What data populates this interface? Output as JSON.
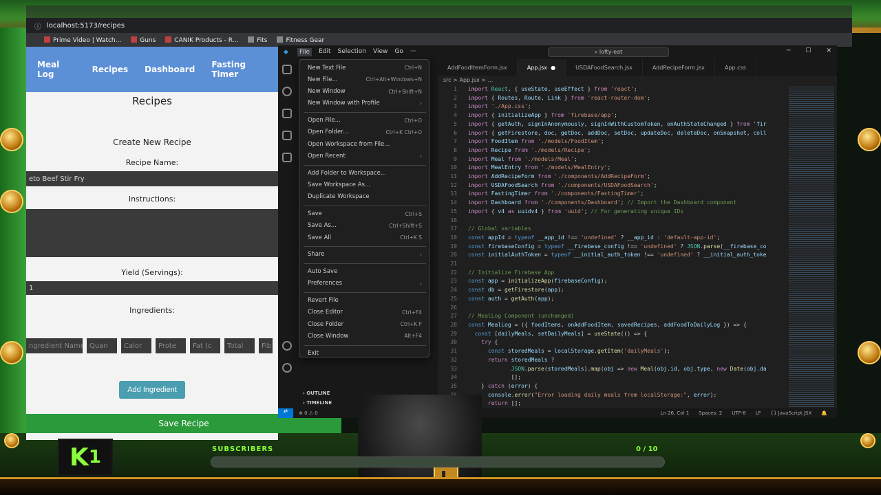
{
  "browser": {
    "url": "localhost:5173/recipes",
    "bookmarks": [
      "Prime Video | Watch...",
      "Guns",
      "CANIK Products - R...",
      "Fits",
      "Fitness Gear"
    ]
  },
  "app": {
    "nav": [
      "Meal Log",
      "Recipes",
      "Dashboard",
      "Fasting Timer"
    ],
    "page_title": "Recipes",
    "form_title": "Create New Recipe",
    "recipe_name_label": "Recipe Name:",
    "recipe_name_value": "eto Beef Stir Fry",
    "instructions_label": "Instructions:",
    "yield_label": "Yield (Servings):",
    "yield_value": "1",
    "ingredients_label": "Ingredients:",
    "ingredient_placeholders": [
      "ngredient Name",
      "Quan",
      "Calor",
      "Prote",
      "Fat (c",
      "Total",
      "Fib"
    ],
    "add_ingredient": "Add Ingredient",
    "save_recipe": "Save Recipe"
  },
  "vscode": {
    "menu": [
      "File",
      "Edit",
      "Selection",
      "View",
      "Go",
      "···"
    ],
    "search": "lofty-eat",
    "tabs": [
      "AddFoodItemForm.jsx",
      "App.jsx",
      "USDAFoodSearch.jsx",
      "AddRecipeForm.jsx",
      "App.css"
    ],
    "breadcrumb": "src > App.jsx > ...",
    "side_sections": [
      "OUTLINE",
      "TIMELINE"
    ],
    "status_left": "⊗ 0 ⚠ 0",
    "status_right": [
      "Ln 26, Col 1",
      "Spaces: 2",
      "UTF-8",
      "LF",
      "{} JavaScript JSX"
    ],
    "code": [
      "import React, { useState, useEffect } from 'react';",
      "import { Routes, Route, Link } from 'react-router-dom';",
      "import './App.css';",
      "import { initializeApp } from 'firebase/app';",
      "import { getAuth, signInAnonymously, signInWithCustomToken, onAuthStateChanged } from 'fir",
      "import { getFirestore, doc, getDoc, addDoc, setDoc, updateDoc, deleteDoc, onSnapshot, coll",
      "import FoodItem from './models/FoodItem';",
      "import Recipe from './models/Recipe';",
      "import Meal from './models/Meal';",
      "import MealEntry from './models/MealEntry';",
      "import AddRecipeForm from './components/AddRecipeForm';",
      "import USDAFoodSearch from './components/USDAFoodSearch';",
      "import FastingTimer from './components/FastingTimer';",
      "import Dashboard from './components/Dashboard'; // Import the Dashboard component",
      "import { v4 as uuidv4 } from 'uuid'; // For generating unique IDs",
      "",
      "// Global variables",
      "const appId = typeof __app_id !== 'undefined' ? __app_id : 'default-app-id';",
      "const firebaseConfig = typeof __firebase_config !== 'undefined' ? JSON.parse(__firebase_co",
      "const initialAuthToken = typeof __initial_auth_token !== 'undefined' ? __initial_auth_toke",
      "",
      "// Initialize Firebase App",
      "const app = initializeApp(firebaseConfig);",
      "const db = getFirestore(app);",
      "const auth = getAuth(app);",
      "",
      "// MealLog Component (unchanged)",
      "const MealLog = ({ foodItems, onAddFoodItem, savedRecipes, addFoodToDailyLog }) => {",
      "  const [dailyMeals, setDailyMeals] = useState(() => {",
      "    try {",
      "      const storedMeals = localStorage.getItem('dailyMeals');",
      "      return storedMeals ?",
      "             JSON.parse(storedMeals).map(obj => new Meal(obj.id, obj.type, new Date(obj.da",
      "             [];",
      "    } catch (error) {",
      "      console.error(\"Error loading daily meals from localStorage:\", error);",
      "      return [];"
    ]
  },
  "file_menu": [
    {
      "label": "New Text File",
      "key": "Ctrl+N"
    },
    {
      "label": "New File...",
      "key": "Ctrl+Alt+Windows+N"
    },
    {
      "label": "New Window",
      "key": "Ctrl+Shift+N"
    },
    {
      "label": "New Window with Profile",
      "key": "›"
    },
    {
      "label": "Open File...",
      "key": "Ctrl+O"
    },
    {
      "label": "Open Folder...",
      "key": "Ctrl+K Ctrl+O"
    },
    {
      "label": "Open Workspace from File...",
      "key": ""
    },
    {
      "label": "Open Recent",
      "key": "›"
    },
    {
      "label": "Add Folder to Workspace...",
      "key": ""
    },
    {
      "label": "Save Workspace As...",
      "key": ""
    },
    {
      "label": "Duplicate Workspace",
      "key": ""
    },
    {
      "label": "Save",
      "key": "Ctrl+S"
    },
    {
      "label": "Save As...",
      "key": "Ctrl+Shift+S"
    },
    {
      "label": "Save All",
      "key": "Ctrl+K S"
    },
    {
      "label": "Share",
      "key": "›"
    },
    {
      "label": "Auto Save",
      "key": ""
    },
    {
      "label": "Preferences",
      "key": "›"
    },
    {
      "label": "Revert File",
      "key": ""
    },
    {
      "label": "Close Editor",
      "key": "Ctrl+F4"
    },
    {
      "label": "Close Folder",
      "key": "Ctrl+K F"
    },
    {
      "label": "Close Window",
      "key": "Alt+F4"
    },
    {
      "label": "Exit",
      "key": ""
    }
  ],
  "hud": {
    "logo": "1",
    "subscribers_label": "SUBSCRIBERS",
    "count": "0 / 10",
    "progress": 0.0,
    "accent": "#8aff3a"
  }
}
